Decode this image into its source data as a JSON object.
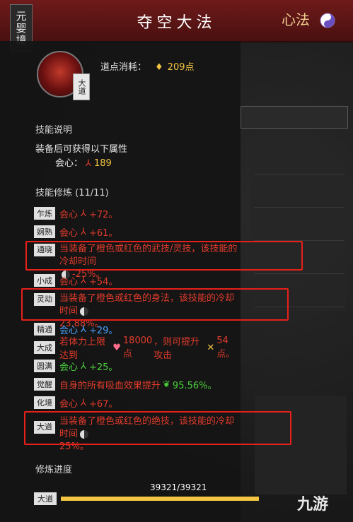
{
  "header": {
    "realm": "元婴境",
    "title": "夺空大法",
    "xinfa": "心法"
  },
  "skill": {
    "badge": "大道",
    "cost_label": "道点消耗：",
    "cost_value": "209点"
  },
  "description": {
    "title": "技能说明",
    "equip_text": "装备后可获得以下属性",
    "attr_label": "会心：",
    "attr_value": "189"
  },
  "cultivation": {
    "title": "技能修炼 (11/11)",
    "rows": [
      {
        "tag": "乍炼",
        "stat": "会心",
        "value": "+72。"
      },
      {
        "tag": "娴熟",
        "stat": "会心",
        "value": "+61。"
      },
      {
        "tag": "通晓",
        "text1": "当装备了橙色或红色的武技/灵技，该技能的冷却时间",
        "text2": "-25%。"
      },
      {
        "tag": "小成",
        "stat": "会心",
        "value": "+54。"
      },
      {
        "tag": "灵动",
        "text1": "当装备了橙色或红色的身法，该技能的冷却时间",
        "text2": "23.88%。"
      },
      {
        "tag": "精通",
        "stat": "会心",
        "value": "+29。"
      },
      {
        "tag": "大成",
        "pre": "若体力上限达到",
        "hp": "18000点",
        "mid": "，则可提升攻击",
        "atk": "54点。"
      },
      {
        "tag": "圆满",
        "stat": "会心",
        "value": "+25。"
      },
      {
        "tag": "觉醒",
        "pre": "自身的所有吸血效果提升",
        "lifesteal": "95.56%。"
      },
      {
        "tag": "化境",
        "stat": "会心",
        "value": "+67。"
      },
      {
        "tag": "大道",
        "text1": "当装备了橙色或红色的绝技，该技能的冷却时间",
        "text2": "25%。"
      }
    ]
  },
  "progress": {
    "label": "修炼进度",
    "value": "39321/39321",
    "tag": "大道",
    "fraction": 1.0
  },
  "watermark": "九游",
  "colors": {
    "accent_red": "#e23b2b",
    "gold": "#f4c542",
    "green": "#4cd13c",
    "blue": "#4aa3ff",
    "highlight": "#e8201a"
  }
}
